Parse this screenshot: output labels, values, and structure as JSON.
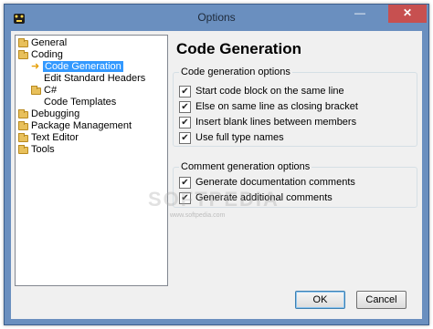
{
  "window": {
    "title": "Options",
    "minimize_glyph": "—",
    "maximize_glyph": "☐",
    "close_glyph": "✕"
  },
  "tree": {
    "items": [
      {
        "label": "General",
        "icon": "folder-icon"
      },
      {
        "label": "Coding",
        "icon": "folder-icon"
      },
      {
        "label": "Code Generation",
        "icon": "arrow-icon",
        "selected": true
      },
      {
        "label": "Edit Standard Headers",
        "icon": "none"
      },
      {
        "label": "C#",
        "icon": "folder-icon"
      },
      {
        "label": "Code Templates",
        "icon": "none"
      },
      {
        "label": "Debugging",
        "icon": "folder-icon"
      },
      {
        "label": "Package Management",
        "icon": "folder-icon"
      },
      {
        "label": "Text Editor",
        "icon": "folder-icon"
      },
      {
        "label": "Tools",
        "icon": "folder-icon"
      }
    ]
  },
  "page": {
    "title": "Code Generation",
    "group1": {
      "title": "Code generation options",
      "options": [
        {
          "label": "Start code block on the same line",
          "checked": true
        },
        {
          "label": "Else on same line as closing bracket",
          "checked": true
        },
        {
          "label": "Insert blank lines between members",
          "checked": true
        },
        {
          "label": "Use full type names",
          "checked": true
        }
      ]
    },
    "group2": {
      "title": "Comment generation options",
      "options": [
        {
          "label": "Generate documentation comments",
          "checked": true
        },
        {
          "label": "Generate additional comments",
          "checked": true
        }
      ]
    }
  },
  "buttons": {
    "ok": "OK",
    "cancel": "Cancel"
  },
  "watermark": {
    "text": "SOFTPEDIA",
    "sub": "www.softpedia.com"
  },
  "colors": {
    "titlebar": "#6a8fbf",
    "close_button": "#c75050",
    "selection": "#3399ff",
    "folder": "#e8c05b"
  }
}
